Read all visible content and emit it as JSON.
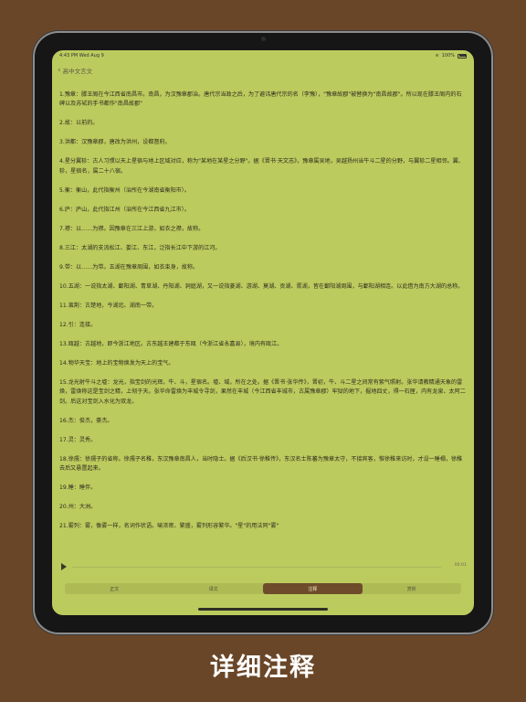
{
  "status_bar": {
    "time": "4:43 PM",
    "date": "Wed Aug 9",
    "battery": "100%"
  },
  "nav": {
    "back_label": "高中文言文"
  },
  "notes": [
    "1.豫章：滕王阁在今江西省南昌市。南昌，为汉豫章郡治。唐代宗当政之后，为了避讳唐代宗的名（李豫），\"豫章故郡\"被替换为\"南昌故郡\"。所以现在滕王阁内的石碑以及苏轼的手书都作\"南昌故郡\"",
    "2.故：以前的。",
    "3.洪都：汉豫章郡，唐改为洪州，设都督府。",
    "4.星分翼轸：古人习惯以天上星宿与地上区域对应，称为\"某地在某星之分野\"。据《晋书·天文志》，豫章属吴地，吴越扬州当牛斗二星的分野，与翼轸二星相邻。翼、轸，星宿名，属二十八宿。",
    "5.衡：衡山，此代指衡州（治所在今湖南省衡阳市）。",
    "6.庐：庐山，此代指江州（治所在今江西省九江市）。",
    "7.襟：以……为襟。因豫章在三江上游，如衣之襟，故称。",
    "8.三江：太湖的支流松江、娄江、东江，泛指长江中下游的江河。",
    "9.带：以……为带。五湖在豫章周围，如衣束身，故称。",
    "10.五湖：一说指太湖、鄱阳湖、青草湖、丹阳湖、洞庭湖，又一说指菱湖、游湖、莫湖、贡湖、胥湖，皆在鄱阳湖周围，与鄱阳湖相连。以此借为南方大湖的总称。",
    "11.蛮荆：古楚地，今湖北、湖南一带。",
    "12.引：连接。",
    "13.瓯越：古越地，即今浙江地区。古东越王建都于东瓯（今浙江省永嘉县），境内有瓯江。",
    "14.物华天宝：地上的宝物焕发为天上的宝气。",
    "15.龙光射牛斗之墟：龙光，指宝剑的光辉。牛、斗，星宿名。墟、域，所在之处。据《晋书·张华传》，晋初，牛、斗二星之间常有紫气照射。张华请教精通天象的雷焕，雷焕称这是宝剑之精，上彻于天。张华命雷焕为丰城令寻剑，果然在丰城（今江西省丰城市，古属豫章郡）牢狱的地下，掘地四丈，得一石匣，内有龙泉、太阿二剑。后这对宝剑入水化为双龙。",
    "16.杰：俊杰，豪杰。",
    "17.灵：灵秀。",
    "18.徐孺：徐孺子的省称。徐孺子名稚，东汉豫章南昌人，当时隐士。据《后汉书·徐稚传》，东汉名士陈蕃为豫章太守，不接宾客，惟徐稚来访时，才设一睡榻，徐稚去后又悬置起来。",
    "19.睡：睡伴。",
    "20.州：大洲。",
    "21.雾列：雾，像雾一样，名词作状语。喻浓密、繁盛，雾列形容繁华。\"星\"的用法同\"雾\""
  ],
  "audio": {
    "time": "00:01"
  },
  "tabs": [
    {
      "label": "正文",
      "active": false
    },
    {
      "label": "译文",
      "active": false
    },
    {
      "label": "注释",
      "active": true
    },
    {
      "label": "赏析",
      "active": false
    }
  ],
  "caption": "详细注释",
  "colors": {
    "background": "#6a4628",
    "screen": "#bccb5e",
    "active_tab": "#6e4b2b"
  }
}
